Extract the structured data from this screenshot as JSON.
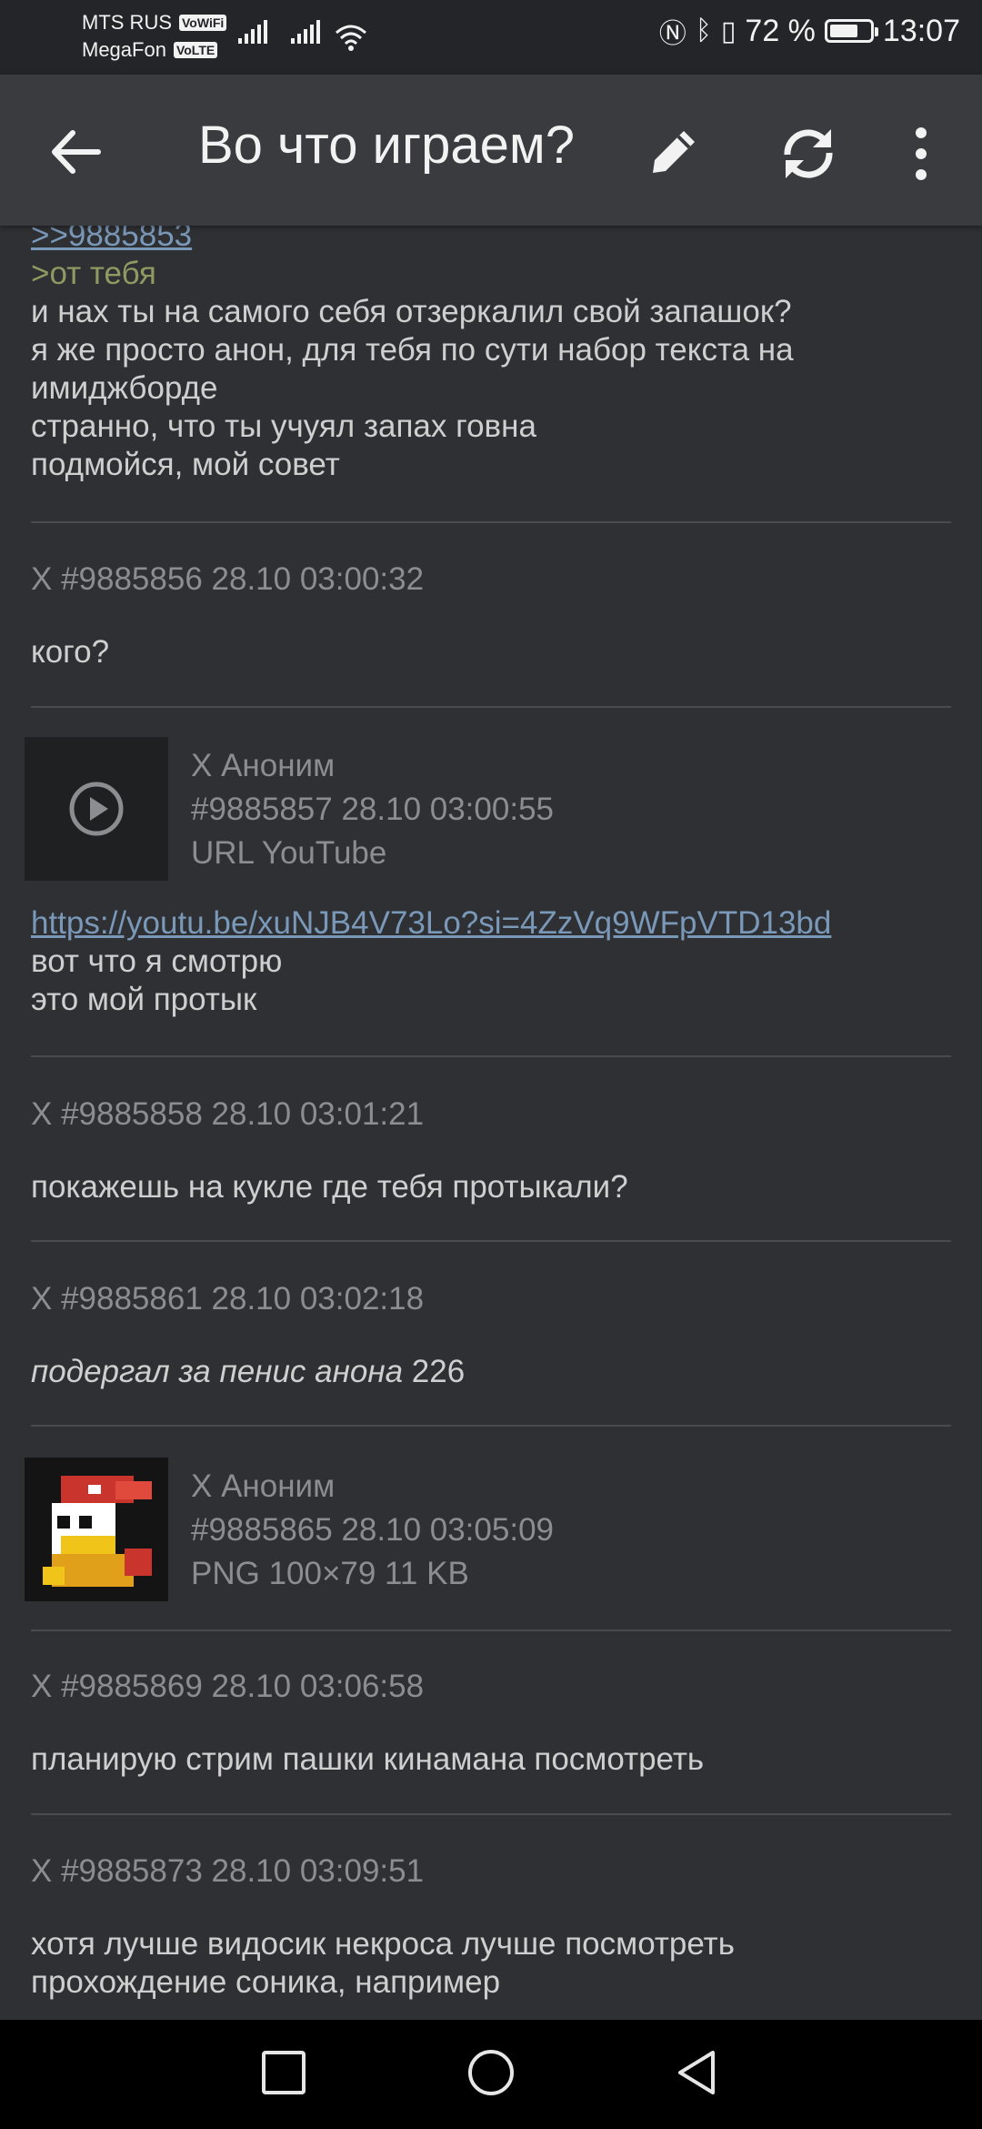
{
  "status_bar": {
    "carrier1": "MTS RUS",
    "carrier1_tag": "VoWiFi",
    "carrier2": "MegaFon",
    "carrier2_tag": "VoLTE",
    "battery_percent": "72 %",
    "battery_level": 0.72,
    "time": "13:07",
    "icons": [
      "signal-icon",
      "wifi-icon",
      "nfc-icon",
      "bluetooth-icon",
      "vibrate-icon",
      "battery-icon"
    ]
  },
  "toolbar": {
    "title": "Во что играем?",
    "icons": [
      "back-arrow-icon",
      "edit-pencil-icon",
      "refresh-icon",
      "more-vertical-icon"
    ]
  },
  "posts": [
    {
      "reply_link": ">>9885853",
      "quote": ">от тебя",
      "lines": [
        "и нах ты на самого себя отзеркалил свой запашок?",
        "я же просто анон, для тебя по сути набор текста на",
        "имиджборде",
        "странно, что ты учуял запах говна",
        "подмойся, мой совет"
      ]
    },
    {
      "meta": "X #9885856 28.10 03:00:32",
      "lines": [
        "кого?"
      ]
    },
    {
      "attachment": {
        "author": "X Аноним",
        "num_date": "#9885857 28.10 03:00:55",
        "info": "URL YouTube",
        "icon": "play-circle-icon"
      },
      "link": "https://youtu.be/xuNJB4V73Lo?si=4ZzVq9WFpVTD13bd",
      "lines": [
        "вот что я смотрю",
        "это мой протык"
      ]
    },
    {
      "meta": "X #9885858 28.10 03:01:21",
      "lines": [
        "покажешь на кукле где тебя протыкали?"
      ]
    },
    {
      "meta": "X #9885861 28.10 03:02:18",
      "italic": "подергал за пенис анона",
      "plain_suffix": " 226"
    },
    {
      "attachment": {
        "author": "X Аноним",
        "num_date": "#9885865 28.10 03:05:09",
        "info": "PNG 100×79 11 KB",
        "icon": "pixel-duck-image"
      }
    },
    {
      "meta": "X #9885869 28.10 03:06:58",
      "lines": [
        "планирую стрим пашки кинамана посмотреть"
      ]
    },
    {
      "meta": "X #9885873 28.10 03:09:51",
      "lines": [
        "хотя лучше видосик некроса лучше посмотреть",
        "прохождение соника, например"
      ]
    }
  ],
  "nav_bar": {
    "icons": [
      "recent-apps-icon",
      "home-icon",
      "back-triangle-icon"
    ]
  },
  "colors": {
    "background": "#2f3033",
    "toolbar": "#3a3b3e",
    "text": "#cfcfcf",
    "meta": "#8c8d90",
    "link": "#7a98b8",
    "quote": "#8f9a63"
  }
}
